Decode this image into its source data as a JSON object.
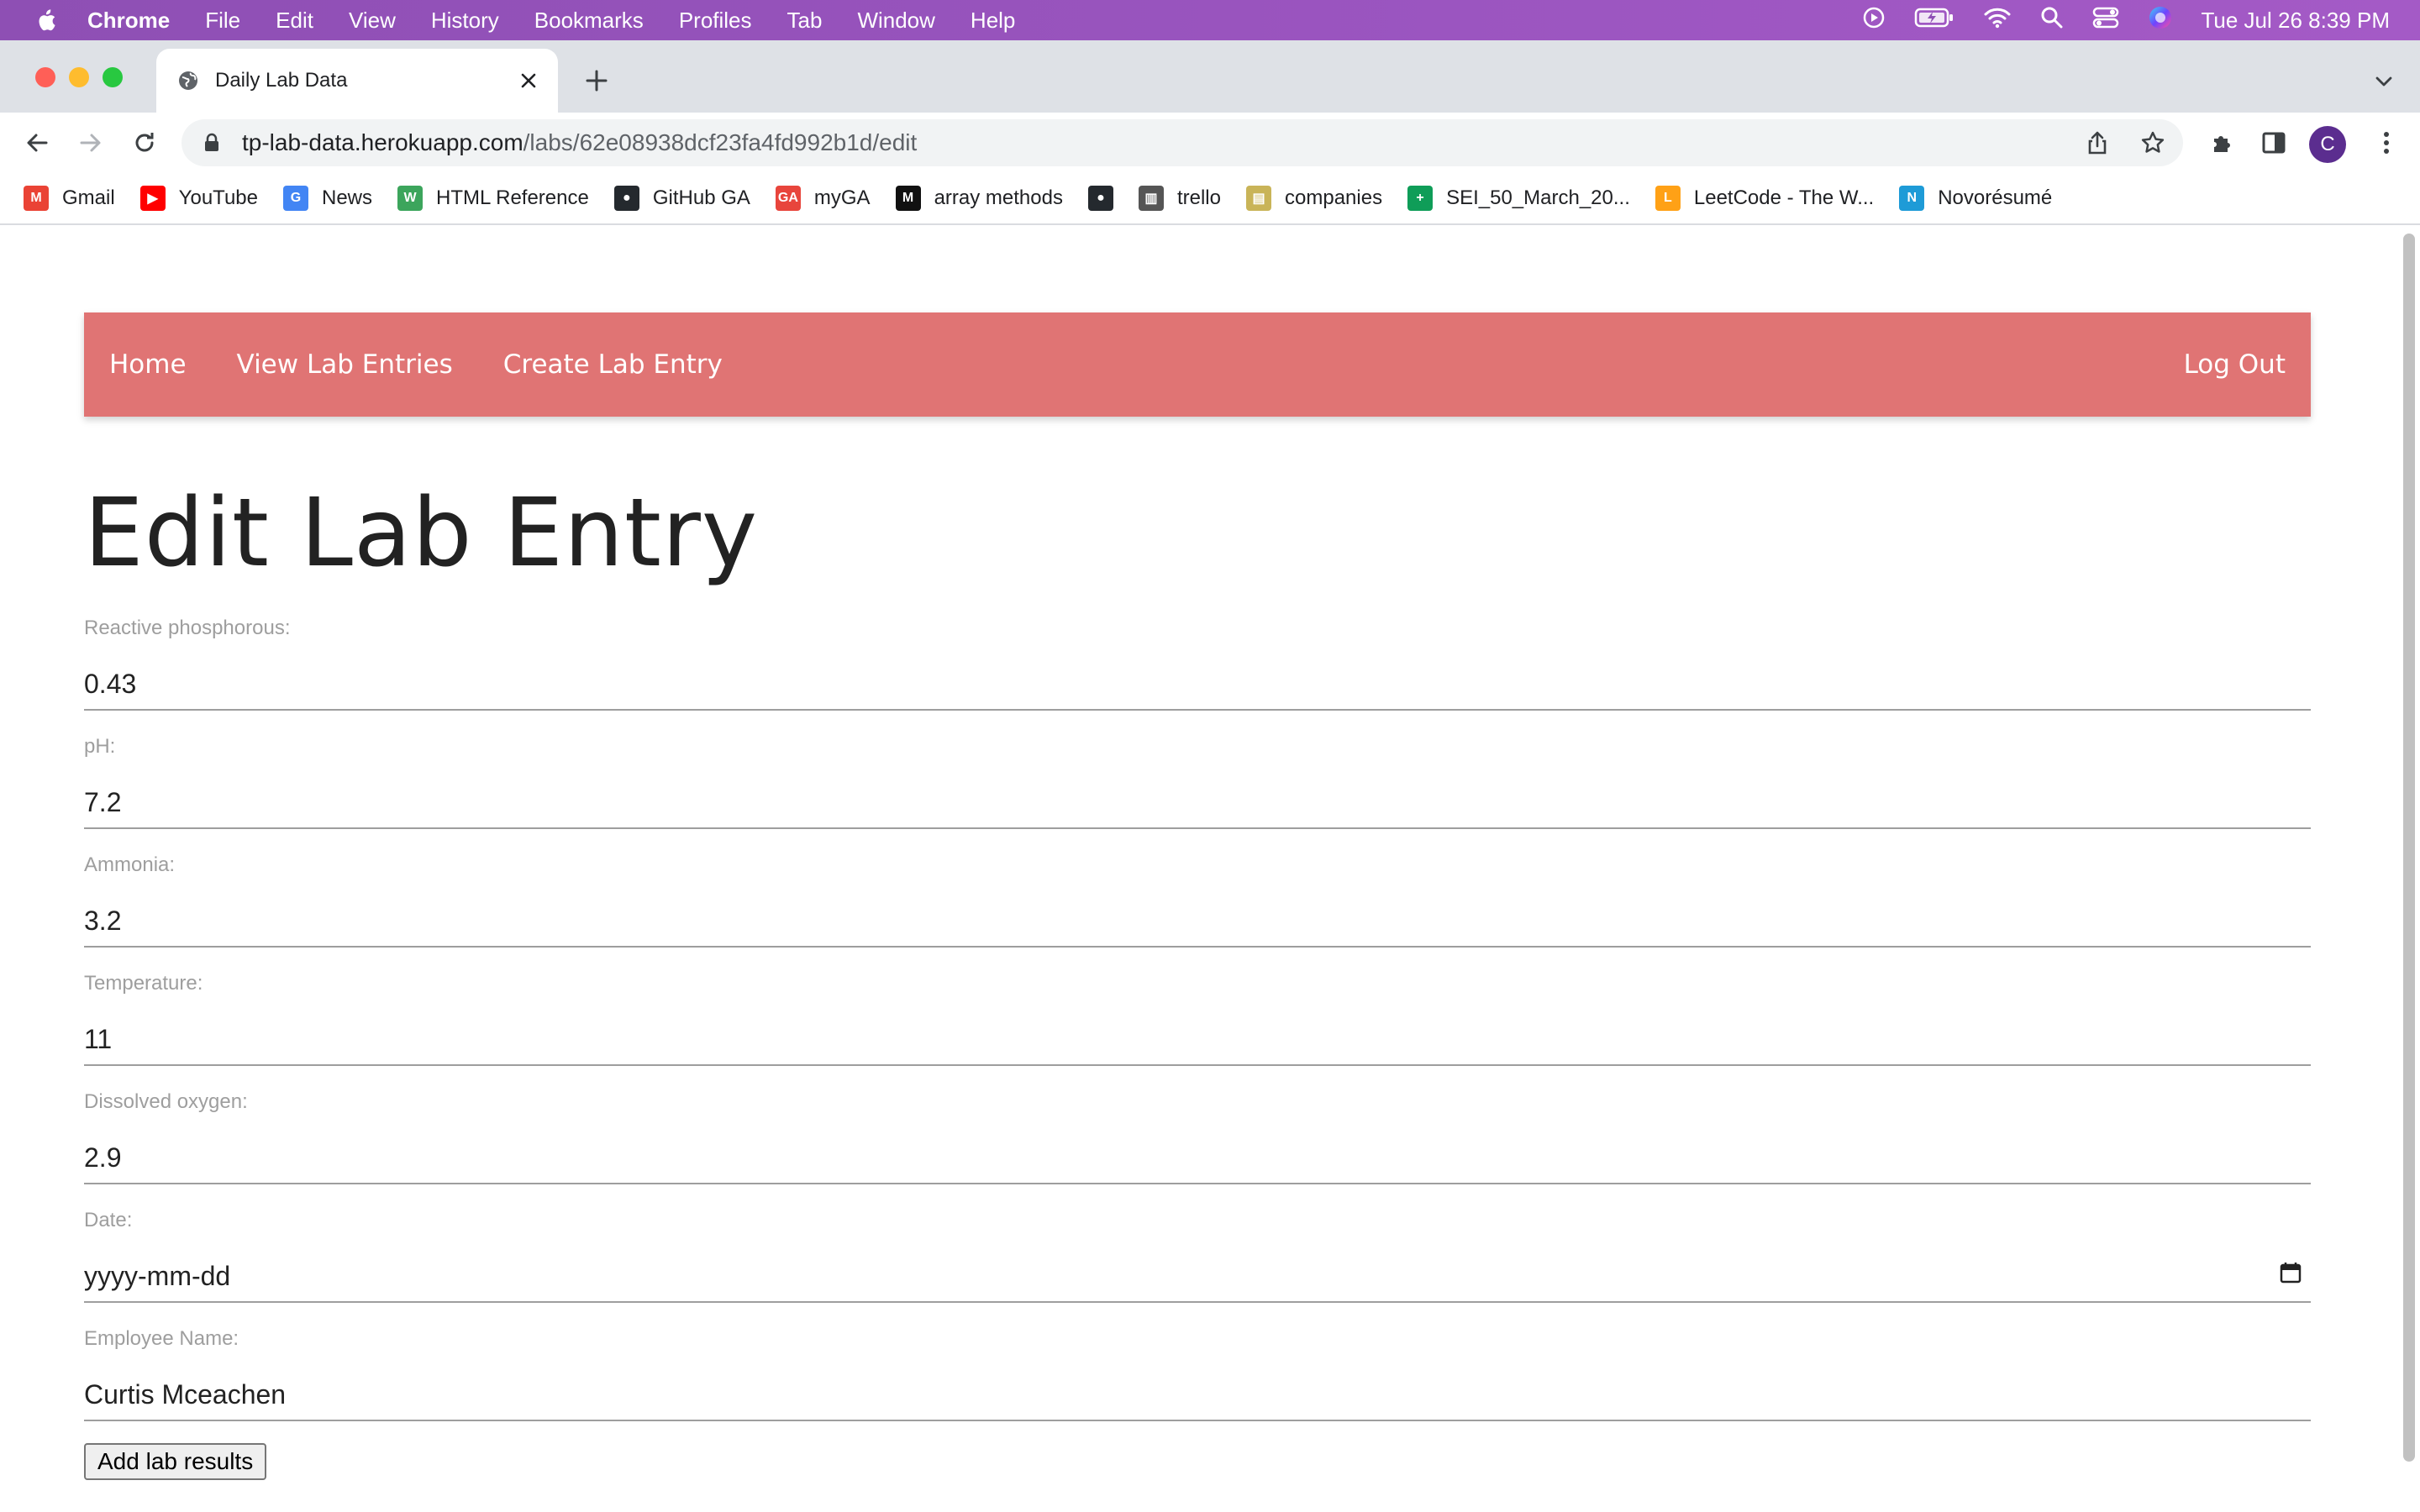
{
  "menubar": {
    "app": "Chrome",
    "items": [
      "File",
      "Edit",
      "View",
      "History",
      "Bookmarks",
      "Profiles",
      "Tab",
      "Window",
      "Help"
    ],
    "clock": "Tue Jul 26  8:39 PM"
  },
  "browser": {
    "tab_title": "Daily Lab Data",
    "url_host": "tp-lab-data.herokuapp.com",
    "url_path": "/labs/62e08938dcf23fa4fd992b1d/edit",
    "profile_initial": "C"
  },
  "bookmarks": [
    {
      "label": "Gmail",
      "icon": "gmail-icon",
      "color": "#ea4335",
      "glyph": "M"
    },
    {
      "label": "YouTube",
      "icon": "youtube-icon",
      "color": "#ff0000",
      "glyph": "▶"
    },
    {
      "label": "News",
      "icon": "news-icon",
      "color": "#4285f4",
      "glyph": "G"
    },
    {
      "label": "HTML Reference",
      "icon": "html-reference-icon",
      "color": "#3ca55c",
      "glyph": "W"
    },
    {
      "label": "GitHub GA",
      "icon": "github-icon",
      "color": "#24292e",
      "glyph": "●"
    },
    {
      "label": "myGA",
      "icon": "ga-icon",
      "color": "#e8453c",
      "glyph": "GA"
    },
    {
      "label": "array methods",
      "icon": "array-methods-icon",
      "color": "#111111",
      "glyph": "M"
    },
    {
      "label": "",
      "icon": "github-icon",
      "color": "#24292e",
      "glyph": "●"
    },
    {
      "label": "trello",
      "icon": "trello-icon",
      "color": "#555555",
      "glyph": "▥"
    },
    {
      "label": "companies",
      "icon": "companies-icon",
      "color": "#c9b458",
      "glyph": "▤"
    },
    {
      "label": "SEI_50_March_20...",
      "icon": "sheets-icon",
      "color": "#0f9d58",
      "glyph": "+"
    },
    {
      "label": "LeetCode - The W...",
      "icon": "leetcode-icon",
      "color": "#ffa116",
      "glyph": "L"
    },
    {
      "label": "Novorésumé",
      "icon": "novoresume-icon",
      "color": "#1e9bd7",
      "glyph": "N"
    }
  ],
  "nav": {
    "home": "Home",
    "view_entries": "View Lab Entries",
    "create_entry": "Create Lab Entry",
    "logout": "Log Out",
    "bg_color": "#e07474"
  },
  "form": {
    "title": "Edit Lab Entry",
    "fields": [
      {
        "label": "Reactive phosphorous:",
        "value": "0.43"
      },
      {
        "label": "pH:",
        "value": "7.2"
      },
      {
        "label": "Ammonia:",
        "value": "3.2"
      },
      {
        "label": "Temperature:",
        "value": "11"
      },
      {
        "label": "Dissolved oxygen:",
        "value": "2.9"
      },
      {
        "label": "Date:",
        "value": "yyyy-mm-dd"
      },
      {
        "label": "Employee Name:",
        "value": "Curtis Mceachen"
      }
    ],
    "submit_label": "Add lab results"
  }
}
